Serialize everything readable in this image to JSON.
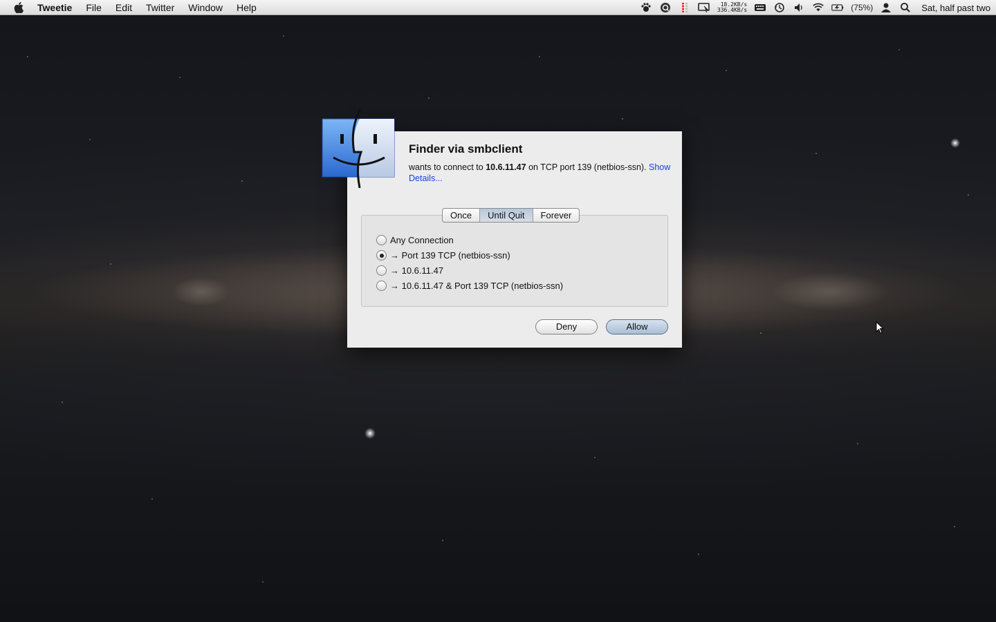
{
  "menubar": {
    "app_name": "Tweetie",
    "items": [
      "File",
      "Edit",
      "Twitter",
      "Window",
      "Help"
    ],
    "net_up": "18.2KB/s",
    "net_down": "336.4KB/s",
    "battery": "(75%)",
    "clock": "Sat, half past two"
  },
  "dialog": {
    "title": "Finder via smbclient",
    "message_prefix": "wants to connect to ",
    "message_host": "10.6.11.47",
    "message_suffix": " on TCP port 139 (netbios-ssn). ",
    "details_link": "Show Details...",
    "duration_tabs": [
      "Once",
      "Until Quit",
      "Forever"
    ],
    "selected_duration": "Until Quit",
    "options": [
      "Any Connection",
      "→ Port 139 TCP (netbios-ssn)",
      "→ 10.6.11.47",
      "→ 10.6.11.47 & Port 139 TCP (netbios-ssn)"
    ],
    "selected_option": "→ Port 139 TCP (netbios-ssn)",
    "deny_label": "Deny",
    "allow_label": "Allow"
  },
  "colors": {
    "link": "#1a3fd6",
    "default_button": "#a9bfd6",
    "finder_blue": "#4a8fe6"
  }
}
